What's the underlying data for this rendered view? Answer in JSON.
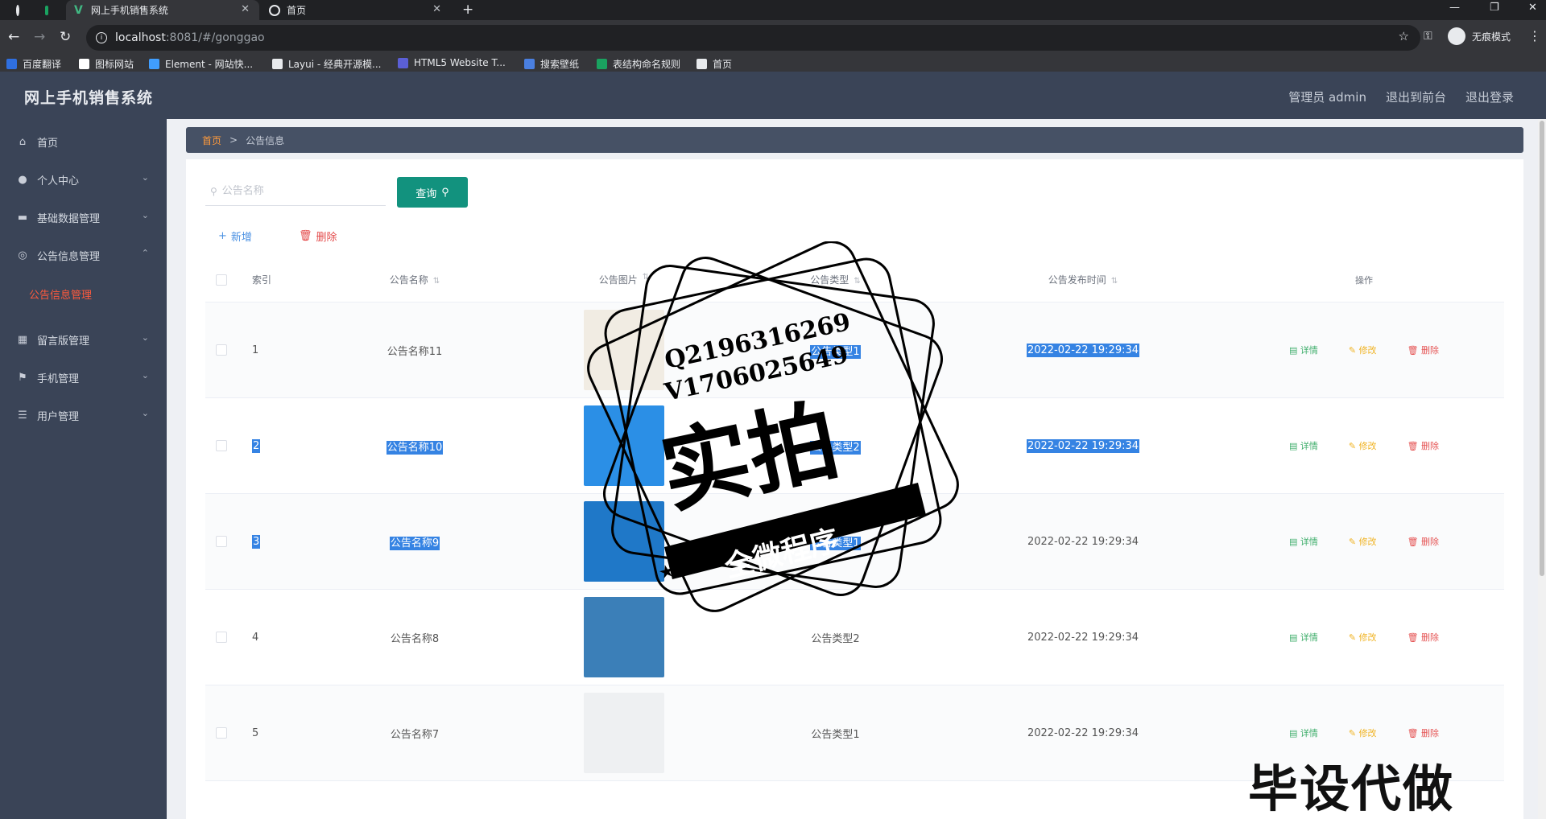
{
  "browser": {
    "active_tab_title": "网上手机销售系统",
    "second_tab_title": "首页",
    "url_host": "localhost",
    "url_path": ":8081/#/gonggao",
    "incognito_label": "无痕模式",
    "bookmarks": [
      {
        "label": "百度翻译",
        "color": "#2f6fe0"
      },
      {
        "label": "图标网站",
        "color": "#ffffff"
      },
      {
        "label": "Element - 网站快...",
        "color": "#409eff"
      },
      {
        "label": "Layui - 经典开源模...",
        "color": "#e8eaed"
      },
      {
        "label": "HTML5 Website T...",
        "color": "#5b5fd6"
      },
      {
        "label": "搜索壁纸",
        "color": "#4a7fe0"
      },
      {
        "label": "表结构命名规则",
        "color": "#1aa260"
      },
      {
        "label": "首页",
        "color": "#e8eaed"
      }
    ]
  },
  "app": {
    "title": "网上手机销售系统",
    "header_links": [
      "管理员 admin",
      "退出到前台",
      "退出登录"
    ]
  },
  "sidebar": {
    "items": [
      {
        "label": "首页",
        "icon": "home-icon",
        "expandable": false
      },
      {
        "label": "个人中心",
        "icon": "user-icon",
        "expandable": true
      },
      {
        "label": "基础数据管理",
        "icon": "briefcase-icon",
        "expandable": true
      },
      {
        "label": "公告信息管理",
        "icon": "circle-icon",
        "expandable": true,
        "expanded": true
      },
      {
        "label": "留言版管理",
        "icon": "grid-icon",
        "expandable": true
      },
      {
        "label": "手机管理",
        "icon": "flag-icon",
        "expandable": true
      },
      {
        "label": "用户管理",
        "icon": "sliders-icon",
        "expandable": true
      }
    ],
    "active_sub": "公告信息管理"
  },
  "breadcrumb": {
    "home": "首页",
    "separator": ">",
    "current": "公告信息"
  },
  "search": {
    "placeholder": "公告名称",
    "button": "查询"
  },
  "actions": {
    "add": "新增",
    "delete": "删除"
  },
  "table": {
    "headers": {
      "index": "索引",
      "name": "公告名称",
      "image": "公告图片",
      "type": "公告类型",
      "time": "公告发布时间",
      "ops": "操作"
    },
    "op_labels": {
      "detail": "详情",
      "edit": "修改",
      "delete": "删除"
    },
    "rows": [
      {
        "index": "1",
        "name": "公告名称11",
        "type": "公告类型1",
        "time": "2022-02-22 19:29:34",
        "image_color": "#f1ece3"
      },
      {
        "index": "2",
        "name": "公告名称10",
        "type": "公告类型2",
        "time": "2022-02-22 19:29:34",
        "image_color": "#2b8fe6"
      },
      {
        "index": "3",
        "name": "公告名称9",
        "type": "公告类型1",
        "time": "2022-02-22 19:29:34",
        "image_color": "#1f78c8"
      },
      {
        "index": "4",
        "name": "公告名称8",
        "type": "公告类型2",
        "time": "2022-02-22 19:29:34",
        "image_color": "#3b7fb8"
      },
      {
        "index": "5",
        "name": "公告名称7",
        "type": "公告类型1",
        "time": "2022-02-22 19:29:34",
        "image_color": "#eef0f2"
      }
    ]
  },
  "watermark": {
    "qq": "Q2196316269",
    "vx": "V1706025649",
    "big": "实拍",
    "banner": "全微程序",
    "bottom": "毕设代做"
  }
}
